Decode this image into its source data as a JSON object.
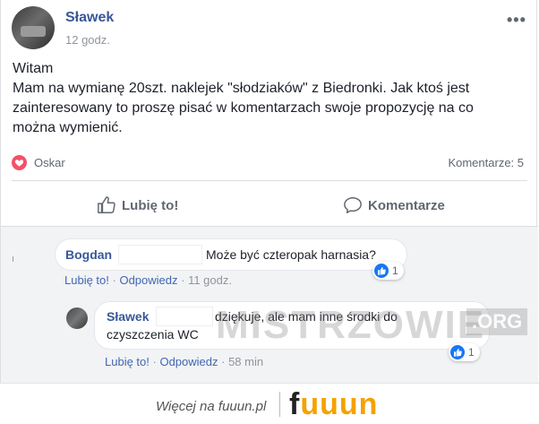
{
  "post": {
    "author": "Sławek",
    "time": "12 godz.",
    "more": "•••",
    "lines": [
      "Witam",
      "Mam na wymianę 20szt. naklejek \"słodziaków\" z Biedronki. Jak ktoś jest",
      "zainteresowany to proszę pisać w komentarzach swoje propozycję na co",
      "można wymienić."
    ],
    "reactor": "Oskar",
    "comments_count": "Komentarze: 5",
    "like_label": "Lubię to!",
    "comment_label": "Komentarze"
  },
  "comments": [
    {
      "name": "Bogdan",
      "text": "Może być czteropak harnasia?",
      "like": "Lubię to!",
      "reply": "Odpowiedz",
      "sep": "·",
      "time": "11 godz.",
      "reactions": "1"
    },
    {
      "name": "Sławek",
      "text_line1": "dziękuje, ale mam inne środki do",
      "text_line2": "czyszczenia WC",
      "like": "Lubię to!",
      "reply": "Odpowiedz",
      "sep": "·",
      "time": "58 min",
      "reactions": "1"
    }
  ],
  "watermark": {
    "main": "MISTRZOWIE",
    "org": ".ORG"
  },
  "footer": {
    "more": "Więcej na fuuun.pl",
    "brand_f": "f",
    "brand_rest": "uuun"
  },
  "colors": {
    "link": "#385898",
    "accent_blue": "#1877f2",
    "heart": "#f25268",
    "brand": "#f5a100"
  }
}
